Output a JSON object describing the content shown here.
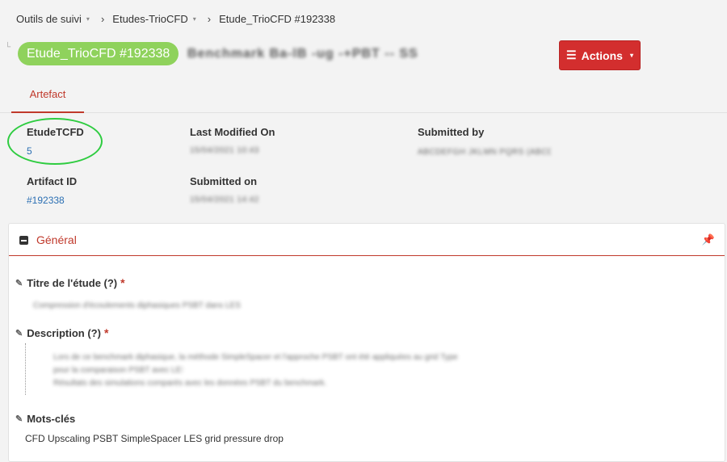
{
  "breadcrumb": {
    "items": [
      {
        "label": "Outils de suivi",
        "has_dropdown": true
      },
      {
        "label": "Etudes-TrioCFD",
        "has_dropdown": true
      },
      {
        "label": "Etude_TrioCFD #192338",
        "has_dropdown": false
      }
    ],
    "separator": "›",
    "caret": "▾"
  },
  "header": {
    "title_badge": "Etude_TrioCFD #192338",
    "blurred_title": "Benchmark Ba-lB -ug -+PBT -- SS",
    "badge_color": "#8fd25c",
    "actions": {
      "label": "Actions",
      "icon": "menu-icon",
      "caret": "▾",
      "color": "#d32e2e"
    }
  },
  "tabs": [
    {
      "label": "Artefact",
      "active": true
    }
  ],
  "fields": {
    "etude_label": "EtudeTCFD",
    "etude_value": "5",
    "artifact_id_label": "Artifact ID",
    "artifact_id_value": "#192338",
    "last_modified_label": "Last Modified On",
    "last_modified_value": "15/04/2021 10:43",
    "submitted_on_label": "Submitted on",
    "submitted_on_value": "15/04/2021 14:42",
    "submitted_by_label": "Submitted by",
    "submitted_by_value": "ABCDEFGH JKLMN PQRS (ABCDEF)"
  },
  "panel": {
    "title": "Général",
    "accent": "#c0392b",
    "titre_label": "Titre de l'étude (?)",
    "titre_value": "Compression d'écoulements diphasiques PSBT dans LES",
    "description_label": "Description (?)",
    "description_line1": "Lors de ce benchmark diphasique, la méthode SimpleSpacer et l'approche PSBT ont été appliquées au grid Type",
    "description_line2": "pour la comparaison PSBT avec LES.",
    "description_line3": "Résultats des simulations comparés avec les données PSBT du benchmark.",
    "keywords_label": "Mots-clés",
    "keywords_value": "CFD Upscaling PSBT SimpleSpacer LES grid pressure drop",
    "required_mark": "*"
  }
}
